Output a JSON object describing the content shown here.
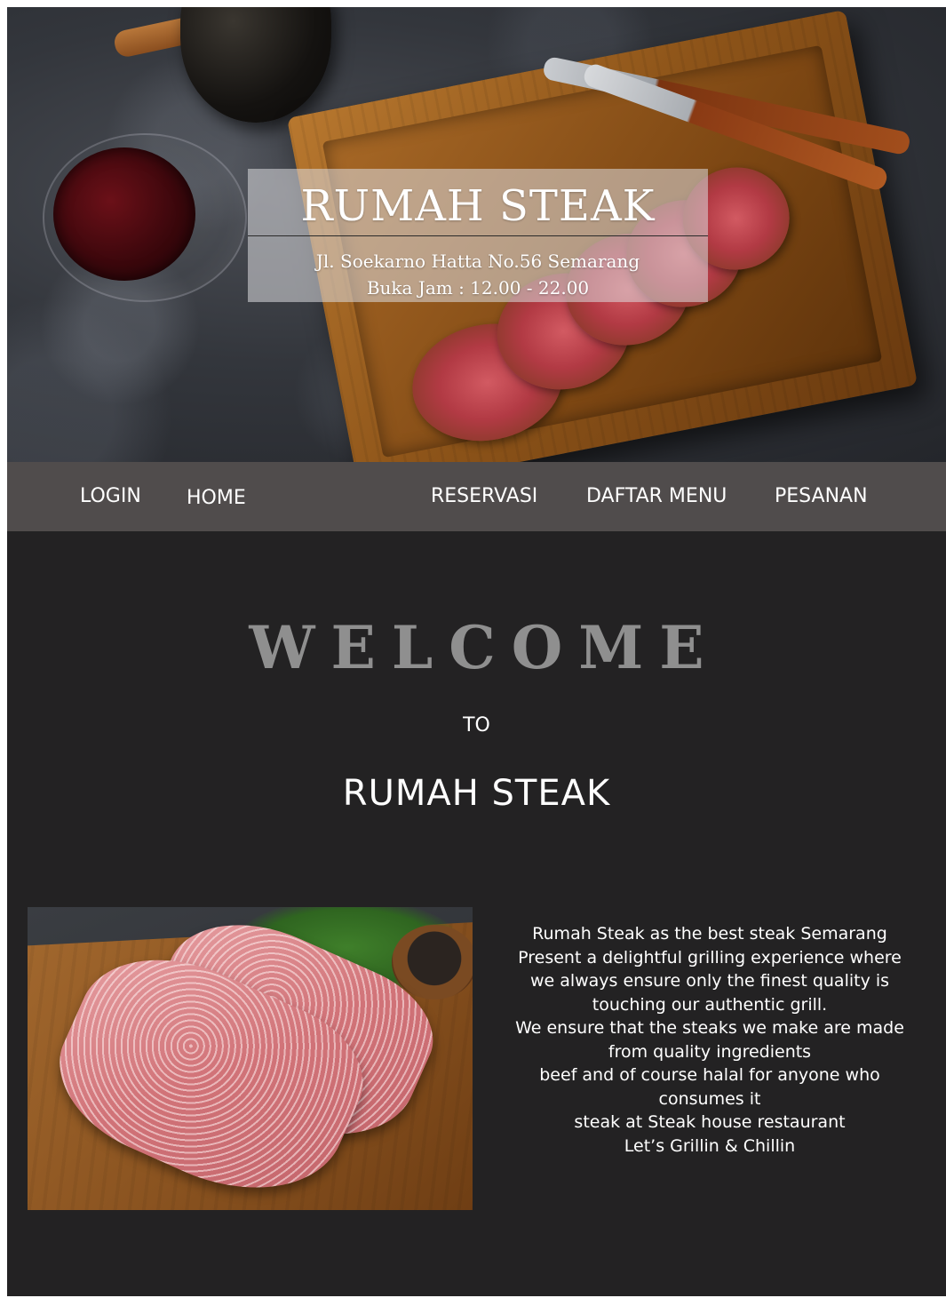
{
  "hero": {
    "title": "RUMAH STEAK",
    "address": "Jl. Soekarno Hatta No.56 Semarang",
    "hours": "Buka Jam : 12.00 - 22.00"
  },
  "nav": {
    "items": [
      {
        "label": "LOGIN"
      },
      {
        "label": "HOME"
      },
      {
        "label": "RESERVASI"
      },
      {
        "label": "DAFTAR MENU"
      },
      {
        "label": "PESANAN"
      }
    ]
  },
  "welcome": {
    "heading": "WELCOME",
    "to": "TO",
    "brand": "RUMAH STEAK"
  },
  "description": {
    "lines": [
      "Rumah Steak as the best steak Semarang",
      "Present a delightful grilling experience where",
      "we always ensure only the finest quality is",
      "touching our authentic grill.",
      "We ensure that the steaks we make are made",
      "from quality ingredients",
      "beef and of course halal for anyone who",
      "consumes it",
      "steak at Steak house restaurant",
      "Let’s Grillin & Chillin"
    ]
  },
  "colors": {
    "page_background": "#232223",
    "nav_background": "#504c4c",
    "welcome_heading": "#8f8f8f",
    "text": "#ffffff"
  }
}
